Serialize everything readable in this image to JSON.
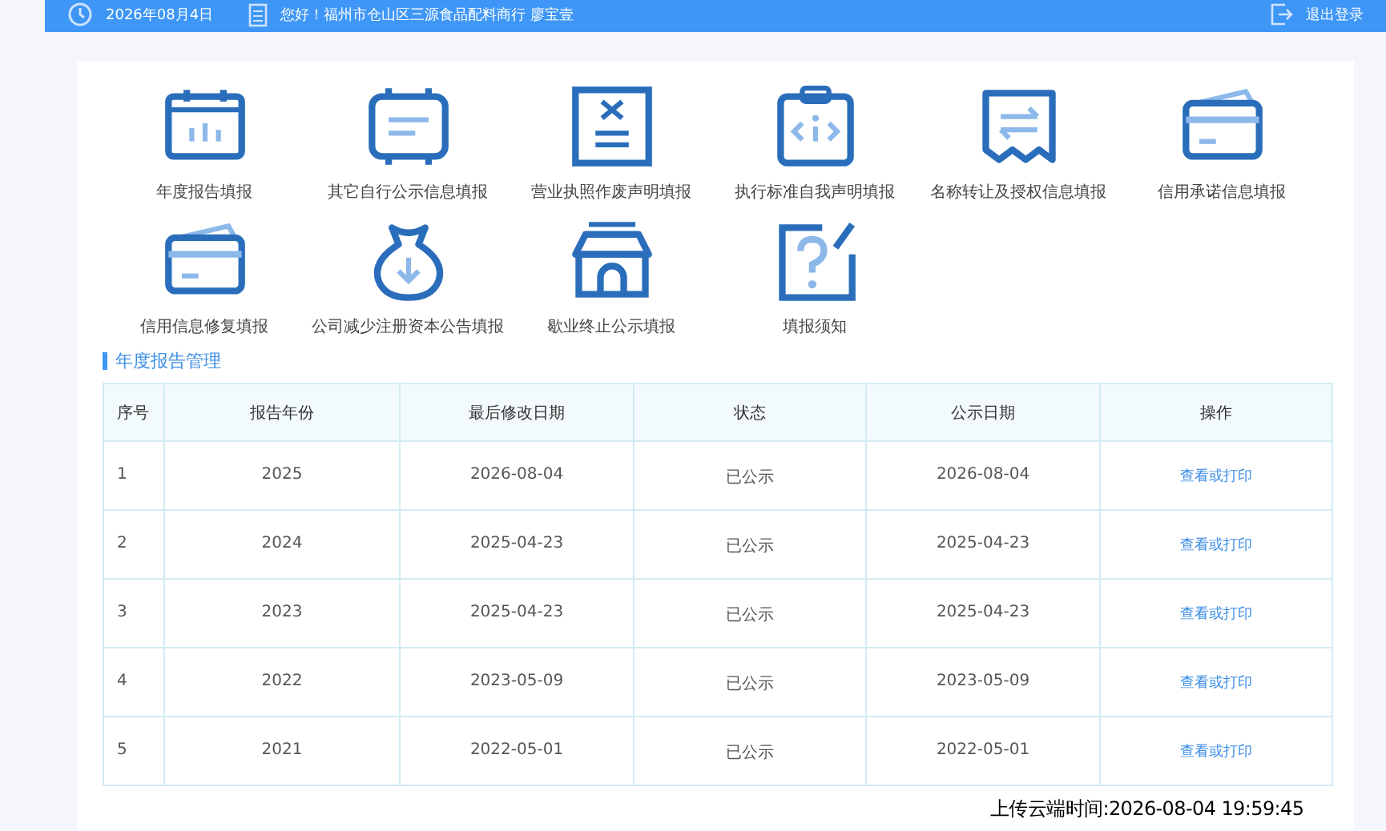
{
  "header": {
    "date": "2026年08月4日",
    "greeting": "您好！福州市仓山区三源食品配料商行 廖宝壹",
    "logout": "退出登录"
  },
  "menu": [
    {
      "label": "年度报告填报"
    },
    {
      "label": "其它自行公示信息填报"
    },
    {
      "label": "营业执照作废声明填报"
    },
    {
      "label": "执行标准自我声明填报"
    },
    {
      "label": "名称转让及授权信息填报"
    },
    {
      "label": "信用承诺信息填报"
    },
    {
      "label": "信用信息修复填报"
    },
    {
      "label": "公司减少注册资本公告填报"
    },
    {
      "label": "歇业终止公示填报"
    },
    {
      "label": "填报须知"
    }
  ],
  "section_title": "年度报告管理",
  "table": {
    "columns": [
      "序号",
      "报告年份",
      "最后修改日期",
      "状态",
      "公示日期",
      "操作"
    ],
    "rows": [
      [
        "1",
        "2025",
        "2026-08-04",
        "已公示",
        "2026-08-04",
        "查看或打印"
      ],
      [
        "2",
        "2024",
        "2025-04-23",
        "已公示",
        "2025-04-23",
        "查看或打印"
      ],
      [
        "3",
        "2023",
        "2025-04-23",
        "已公示",
        "2025-04-23",
        "查看或打印"
      ],
      [
        "4",
        "2022",
        "2023-05-09",
        "已公示",
        "2023-05-09",
        "查看或打印"
      ],
      [
        "5",
        "2021",
        "2022-05-01",
        "已公示",
        "2022-05-01",
        "查看或打印"
      ]
    ]
  },
  "overlay_text": "上传云端时间:2026-08-04 19:59:45"
}
